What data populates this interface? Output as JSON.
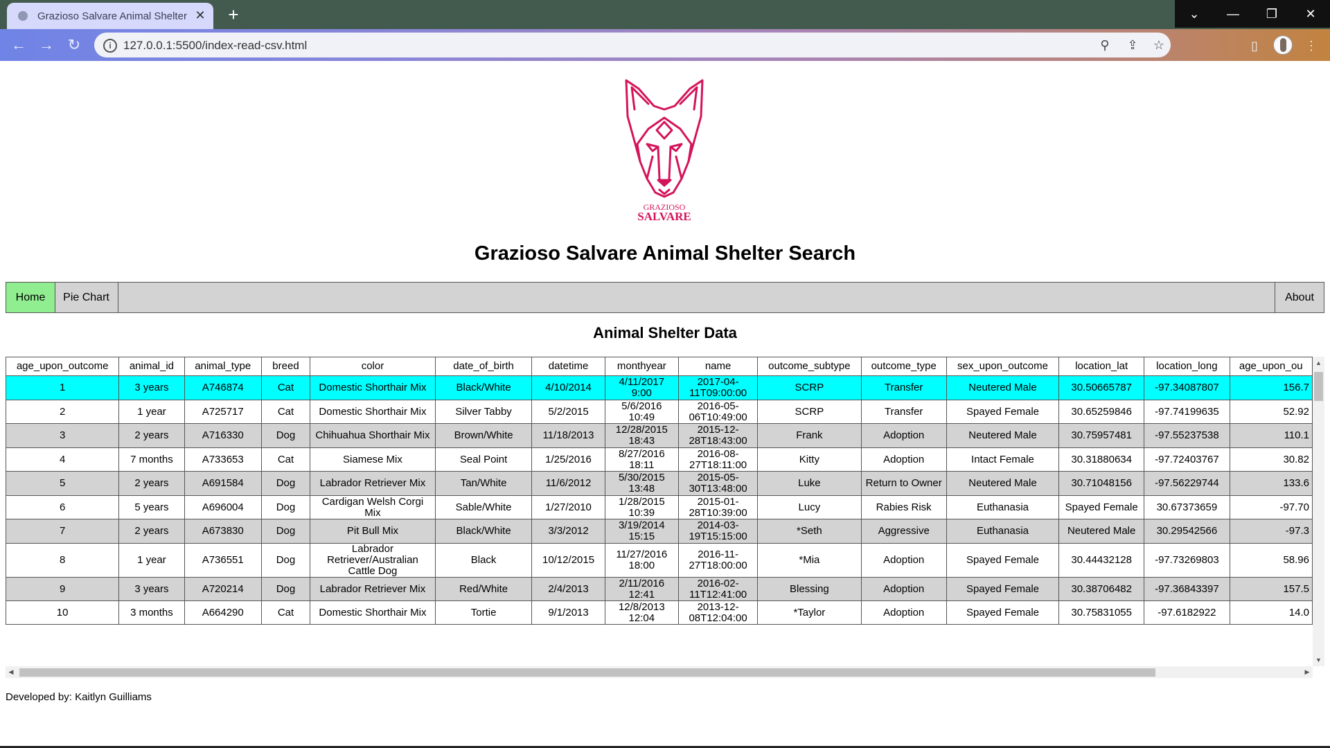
{
  "browser": {
    "tab_title": "Grazioso Salvare Animal Shelter",
    "url": "127.0.0.1:5500/index-read-csv.html",
    "icons": [
      "back-icon",
      "forward-icon",
      "reload-icon",
      "info-icon",
      "zoom-icon",
      "share-icon",
      "star-icon",
      "side-panel-icon",
      "profile-avatar",
      "menu-icon"
    ]
  },
  "logo": {
    "line1": "GRAZIOSO",
    "line2": "SALVARE",
    "color": "#d4145a"
  },
  "page": {
    "title": "Grazioso Salvare Animal Shelter Search",
    "subtitle": "Animal Shelter Data",
    "footer": "Developed by: Kaitlyn Guilliams"
  },
  "nav": {
    "home": "Home",
    "pie": "Pie Chart",
    "about": "About",
    "active_color": "#90ee90"
  },
  "table": {
    "headers": [
      "age_upon_outcome",
      "animal_id",
      "animal_type",
      "breed",
      "color",
      "date_of_birth",
      "datetime",
      "monthyear",
      "name",
      "outcome_subtype",
      "outcome_type",
      "sex_upon_outcome",
      "location_lat",
      "location_long",
      "age_upon_ou"
    ],
    "rows": [
      [
        "1",
        "3 years",
        "A746874",
        "Cat",
        "Domestic Shorthair Mix",
        "Black/White",
        "4/10/2014",
        "4/11/2017 9:00",
        "2017-04-11T09:00:00",
        "",
        "SCRP",
        "Transfer",
        "Neutered Male",
        "30.50665787",
        "-97.34087807",
        "156.7"
      ],
      [
        "2",
        "1 year",
        "A725717",
        "Cat",
        "Domestic Shorthair Mix",
        "Silver Tabby",
        "5/2/2015",
        "5/6/2016 10:49",
        "2016-05-06T10:49:00",
        "",
        "SCRP",
        "Transfer",
        "Spayed Female",
        "30.65259846",
        "-97.74199635",
        "52.92"
      ],
      [
        "3",
        "2 years",
        "A716330",
        "Dog",
        "Chihuahua Shorthair Mix",
        "Brown/White",
        "11/18/2013",
        "12/28/2015 18:43",
        "2015-12-28T18:43:00",
        "Frank",
        "",
        "Adoption",
        "Neutered Male",
        "30.75957481",
        "-97.55237538",
        "110.1"
      ],
      [
        "4",
        "7 months",
        "A733653",
        "Cat",
        "Siamese Mix",
        "Seal Point",
        "1/25/2016",
        "8/27/2016 18:11",
        "2016-08-27T18:11:00",
        "Kitty",
        "",
        "Adoption",
        "Intact Female",
        "30.31880634",
        "-97.72403767",
        "30.82"
      ],
      [
        "5",
        "2 years",
        "A691584",
        "Dog",
        "Labrador Retriever Mix",
        "Tan/White",
        "11/6/2012",
        "5/30/2015 13:48",
        "2015-05-30T13:48:00",
        "Luke",
        "",
        "Return to Owner",
        "Neutered Male",
        "30.71048156",
        "-97.56229744",
        "133.6"
      ],
      [
        "6",
        "5 years",
        "A696004",
        "Dog",
        "Cardigan Welsh Corgi Mix",
        "Sable/White",
        "1/27/2010",
        "1/28/2015 10:39",
        "2015-01-28T10:39:00",
        "Lucy",
        "Rabies Risk",
        "Euthanasia",
        "Spayed Female",
        "30.67373659",
        "-97.70"
      ],
      [
        "7",
        "2 years",
        "A673830",
        "Dog",
        "Pit Bull Mix",
        "Black/White",
        "3/3/2012",
        "3/19/2014 15:15",
        "2014-03-19T15:15:00",
        "*Seth",
        "Aggressive",
        "Euthanasia",
        "Neutered Male",
        "30.29542566",
        "-97.3"
      ],
      [
        "8",
        "1 year",
        "A736551",
        "Dog",
        "Labrador Retriever/Australian Cattle Dog",
        "Black",
        "10/12/2015",
        "11/27/2016 18:00",
        "2016-11-27T18:00:00",
        "*Mia",
        "",
        "Adoption",
        "Spayed Female",
        "30.44432128",
        "-97.73269803",
        "58.96"
      ],
      [
        "9",
        "3 years",
        "A720214",
        "Dog",
        "Labrador Retriever Mix",
        "Red/White",
        "2/4/2013",
        "2/11/2016 12:41",
        "2016-02-11T12:41:00",
        "Blessing",
        "",
        "Adoption",
        "Spayed Female",
        "30.38706482",
        "-97.36843397",
        "157.5"
      ],
      [
        "10",
        "3 months",
        "A664290",
        "Cat",
        "Domestic Shorthair Mix",
        "Tortie",
        "9/1/2013",
        "12/8/2013 12:04",
        "2013-12-08T12:04:00",
        "*Taylor",
        "",
        "Adoption",
        "Spayed Female",
        "30.75831055",
        "-97.6182922",
        "14.0"
      ]
    ]
  }
}
